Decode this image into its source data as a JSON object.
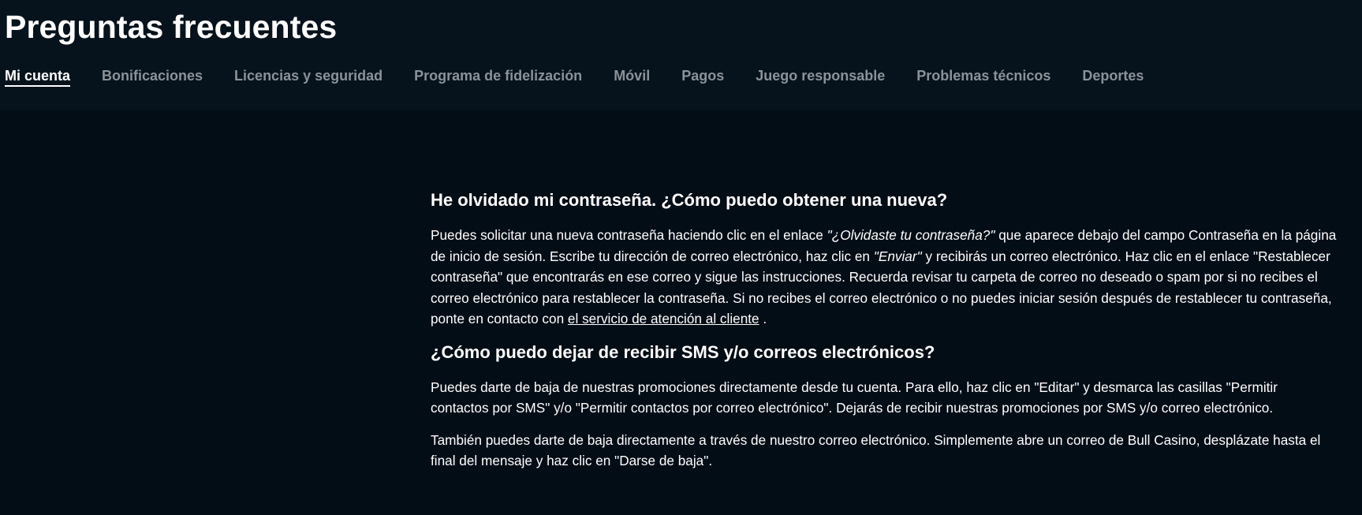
{
  "header": {
    "title": "Preguntas frecuentes",
    "tabs": [
      {
        "label": "Mi cuenta",
        "active": true
      },
      {
        "label": "Bonificaciones"
      },
      {
        "label": "Licencias y seguridad"
      },
      {
        "label": "Programa de fidelización"
      },
      {
        "label": "Móvil"
      },
      {
        "label": "Pagos"
      },
      {
        "label": "Juego responsable"
      },
      {
        "label": "Problemas técnicos"
      },
      {
        "label": "Deportes"
      }
    ]
  },
  "faq": [
    {
      "question": "He olvidado mi contraseña. ¿Cómo puedo obtener una nueva?",
      "answer": {
        "t1": "Puedes solicitar una nueva contraseña haciendo clic en el enlace ",
        "em1": "\"¿Olvidaste tu contraseña?\"",
        "t2": " que aparece debajo del campo Contraseña en la página de inicio de sesión. Escribe tu dirección de correo electrónico, haz clic en ",
        "em2": "\"Enviar\"",
        "t3": " y recibirás un correo electrónico. Haz clic en el enlace \"Restablecer contraseña\" que encontrarás en ese correo y sigue las instrucciones. Recuerda revisar tu carpeta de correo no deseado o spam por si no recibes el correo electrónico para restablecer la contraseña. Si no recibes el correo electrónico o no puedes iniciar sesión después de restablecer tu contraseña, ponte en contacto con ",
        "link": "el servicio de atención al cliente",
        "t4": " ."
      }
    },
    {
      "question": "¿Cómo puedo dejar de recibir SMS y/o correos electrónicos?",
      "paragraphs": [
        "Puedes darte de baja de nuestras promociones directamente desde tu cuenta. Para ello, haz clic en \"Editar\" y desmarca las casillas \"Permitir contactos por SMS\" y/o \"Permitir contactos por correo electrónico\". Dejarás de recibir nuestras promociones por SMS y/o correo electrónico.",
        "También puedes darte de baja directamente a través de nuestro correo electrónico. Simplemente abre un correo de Bull Casino, desplázate hasta el final del mensaje y haz clic en \"Darse de baja\"."
      ]
    }
  ],
  "colors": {
    "background": "#030d16",
    "header_background": "#06131c",
    "tab_inactive": "#8b9299",
    "text": "#ffffff"
  }
}
